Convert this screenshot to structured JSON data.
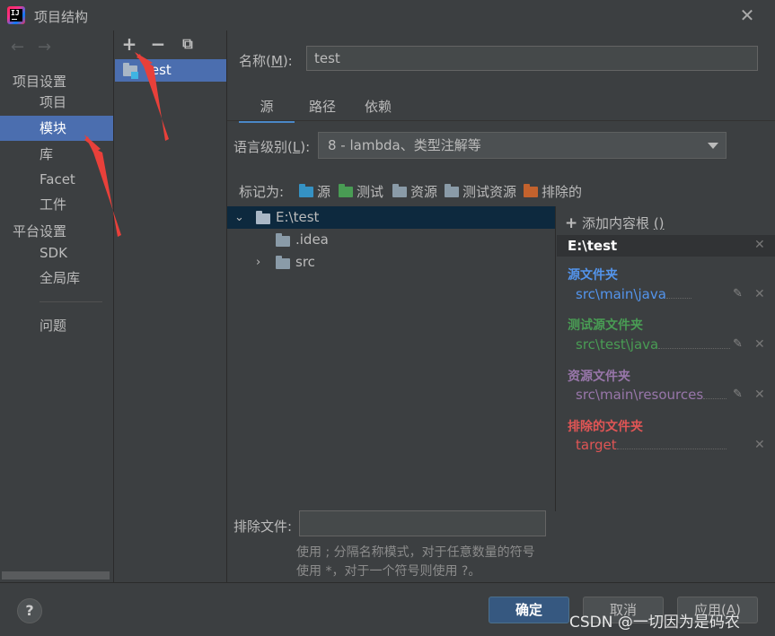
{
  "window": {
    "title": "项目结构"
  },
  "nav": {
    "sections": {
      "project_settings": "项目设置",
      "platform_settings": "平台设置"
    },
    "items": {
      "project": "项目",
      "modules": "模块",
      "libraries": "库",
      "facets": "Facet",
      "artifacts": "工件",
      "sdk": "SDK",
      "global_libs": "全局库",
      "problems": "问题"
    }
  },
  "modules": {
    "list": [
      {
        "name": "test"
      }
    ]
  },
  "module": {
    "name_label": "名称(",
    "name_mnemonic": "M",
    "name_label_end": "):",
    "name_value": "test",
    "tabs": [
      "源",
      "路径",
      "依赖"
    ],
    "language_label": "语言级别(",
    "language_mnemonic": "L",
    "language_label_end": "):",
    "language_value": "8 - lambda、类型注解等",
    "mark_as_label": "标记为:",
    "marks": [
      {
        "label": "源",
        "color": "#3592c4"
      },
      {
        "label": "测试",
        "color": "#499c54"
      },
      {
        "label": "资源",
        "color": "#8a9ba8"
      },
      {
        "label": "测试资源",
        "color": "#8a9ba8"
      },
      {
        "label": "排除的",
        "color": "#c3622d"
      }
    ],
    "tree": {
      "root": "E:\\test",
      "child1": ".idea",
      "child2": "src"
    },
    "exclude_label": "排除文件:",
    "exclude_value": "",
    "hint_line1": "使用 ; 分隔名称模式，对于任意数量的符号",
    "hint_line2": "使用 *，对于一个符号则使用 ?。"
  },
  "roots": {
    "add_label": "添加内容根",
    "add_suffix": "()",
    "root_path": "E:\\test",
    "categories": [
      {
        "title": "源文件夹",
        "path": "src\\main\\java",
        "color": "#5394ec"
      },
      {
        "title": "测试源文件夹",
        "path": "src\\test\\java",
        "color": "#499c54"
      },
      {
        "title": "资源文件夹",
        "path": "src\\main\\resources",
        "color": "#9876aa"
      },
      {
        "title": "排除的文件夹",
        "path": "target",
        "color": "#e05555"
      }
    ]
  },
  "buttons": {
    "ok": "确定",
    "cancel": "取消",
    "apply": "应用(A)",
    "help": "?"
  },
  "watermark": "CSDN @一切因为是码农"
}
